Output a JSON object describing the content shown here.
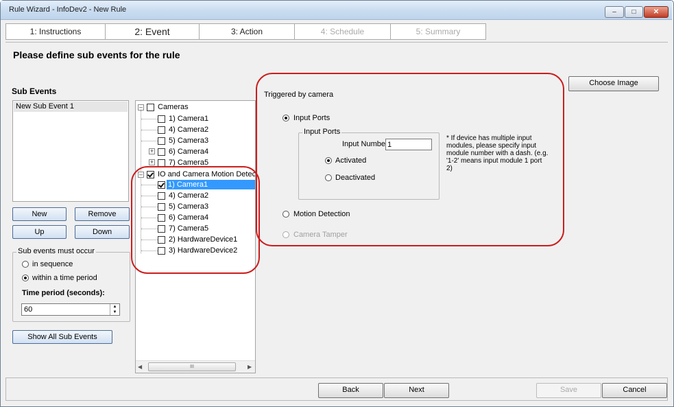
{
  "window": {
    "title": "Rule Wizard - InfoDev2 - New Rule"
  },
  "tabs": [
    {
      "label": "1: Instructions"
    },
    {
      "label": "2: Event"
    },
    {
      "label": "3: Action"
    },
    {
      "label": "4: Schedule"
    },
    {
      "label": "5: Summary"
    }
  ],
  "page": {
    "heading": "Please define sub events for the rule"
  },
  "sub_events": {
    "title": "Sub Events",
    "items": [
      "New Sub Event 1"
    ],
    "new_label": "New",
    "remove_label": "Remove",
    "up_label": "Up",
    "down_label": "Down",
    "occur_group_label": "Sub events must occur",
    "in_sequence_label": "in sequence",
    "within_period_label": "within a time period",
    "time_period_label": "Time period (seconds):",
    "time_period_value": "60",
    "show_all_label": "Show All Sub Events"
  },
  "tree": {
    "cameras_label": "Cameras",
    "cameras_children": [
      "1) Camera1",
      "4) Camera2",
      "5) Camera3",
      "6) Camera4",
      "7) Camera5"
    ],
    "io_label": "IO and Camera Motion Detection",
    "io_children": [
      "1) Camera1",
      "4) Camera2",
      "5) Camera3",
      "6) Camera4",
      "7) Camera5",
      "2) HardwareDevice1",
      "3) HardwareDevice2"
    ],
    "scroll_thumb_glyph": "III"
  },
  "trigger": {
    "title": "Triggered by camera",
    "input_ports_label": "Input Ports",
    "group_label": "Input Ports",
    "input_number_label": "Input Number",
    "input_number_value": "1",
    "activated_label": "Activated",
    "deactivated_label": "Deactivated",
    "note": "* If device has multiple input modules, please specify input module number with a dash. (e.g. '1-2' means input module 1 port 2)",
    "motion_label": "Motion Detection",
    "tamper_label": "Camera Tamper",
    "choose_image_label": "Choose Image"
  },
  "footer": {
    "back_label": "Back",
    "next_label": "Next",
    "save_label": "Save",
    "cancel_label": "Cancel"
  },
  "colors": {
    "highlight": "#cc1d1d",
    "selection": "#3399ff"
  }
}
